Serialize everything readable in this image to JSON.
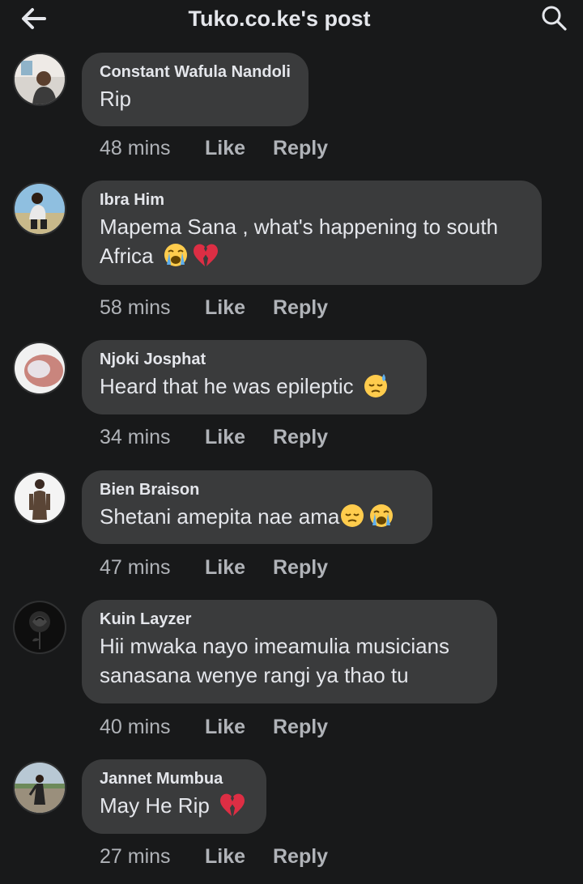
{
  "header": {
    "title": "Tuko.co.ke's post",
    "back_icon": "arrow-left-icon",
    "search_icon": "search-icon"
  },
  "colors": {
    "background": "#18191a",
    "bubble": "#3a3b3c",
    "primary_text": "#e4e6eb",
    "secondary_text": "#b0b3b8"
  },
  "comments": [
    {
      "author": "Constant Wafula Nandoli",
      "text": "Rip",
      "emojis": [],
      "time": "48 mins",
      "like_label": "Like",
      "reply_label": "Reply"
    },
    {
      "author": "Ibra Him",
      "text_line1": "Mapema Sana , what's happening to south",
      "text_line2": "Africa",
      "emojis": [
        "loudly-crying-face-emoji",
        "broken-heart-emoji"
      ],
      "time": "58 mins",
      "like_label": "Like",
      "reply_label": "Reply"
    },
    {
      "author": "Njoki Josphat",
      "text": "Heard that he was epileptic",
      "emojis": [
        "downcast-face-with-sweat-emoji"
      ],
      "time": "34 mins",
      "like_label": "Like",
      "reply_label": "Reply"
    },
    {
      "author": "Bien Braison",
      "text": "Shetani amepita nae ama",
      "emojis": [
        "pensive-face-emoji",
        "loudly-crying-face-emoji"
      ],
      "time": "47 mins",
      "like_label": "Like",
      "reply_label": "Reply"
    },
    {
      "author": "Kuin Layzer",
      "text_line1": "Hii mwaka nayo imeamulia musicians",
      "text_line2": "sanasana wenye rangi ya thao tu",
      "emojis": [],
      "time": "40 mins",
      "like_label": "Like",
      "reply_label": "Reply"
    },
    {
      "author": "Jannet Mumbua",
      "text": "May He Rip",
      "emojis": [
        "broken-heart-emoji"
      ],
      "time": "27 mins",
      "like_label": "Like",
      "reply_label": "Reply"
    }
  ]
}
